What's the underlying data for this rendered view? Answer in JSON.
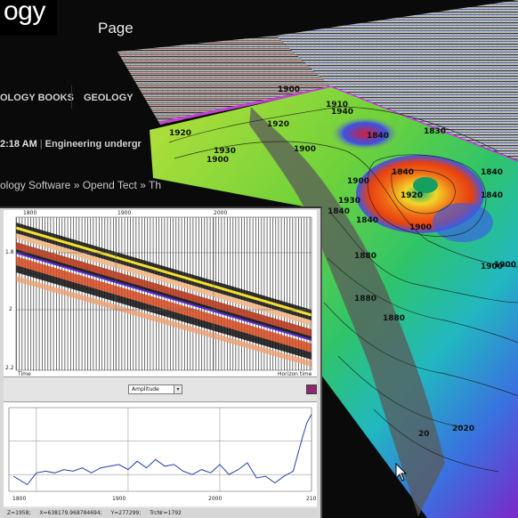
{
  "site": {
    "logo": "ogy",
    "logo_sub": "Page",
    "nav": [
      "OLOGY BOOKS",
      "GEOLOGY"
    ],
    "ticker": {
      "time": "2:18 AM",
      "separator": "|",
      "headline": "Engineering undergr"
    },
    "breadcrumb": "ology Software » Opend Tect » Th"
  },
  "scene": {
    "contour_labels": [
      "1900",
      "1910",
      "1920",
      "1940",
      "1930",
      "1920",
      "1900",
      "1900",
      "1840",
      "1830",
      "1840",
      "1920",
      "1900",
      "1840",
      "1840",
      "1930",
      "1900",
      "1900",
      "1880",
      "1880",
      "1900",
      "1880",
      "1840",
      "1840",
      "2020",
      "20"
    ]
  },
  "window": {
    "trace_axis": {
      "x_ticks": [
        "1800",
        "1900",
        "2000"
      ],
      "y_ticks": [
        "1.8",
        "2",
        "2.2"
      ],
      "left_label": "Time",
      "right_label": "Horizon time"
    },
    "attribute_select": "Amplitude",
    "amp_axis": {
      "x_ticks": [
        "1800",
        "1900",
        "2000",
        "210"
      ]
    },
    "status": {
      "z": "Z=1958;",
      "x": "X=638179.968784694;",
      "y": "Y=277299;",
      "trc": "TrcNr=1792"
    }
  },
  "chart_data": {
    "type": "line",
    "x": [
      1775,
      1790,
      1800,
      1810,
      1820,
      1830,
      1840,
      1850,
      1860,
      1870,
      1880,
      1890,
      1900,
      1910,
      1920,
      1930,
      1940,
      1950,
      1960,
      1970,
      1980,
      1990,
      2000,
      2010,
      2020,
      2030,
      2040,
      2050,
      2060,
      2070,
      2080,
      2090,
      2095,
      2100
    ],
    "values": [
      -0.55,
      -0.8,
      -0.45,
      -0.4,
      -0.45,
      -0.35,
      -0.4,
      -0.3,
      -0.45,
      -0.3,
      -0.25,
      -0.2,
      -0.35,
      -0.1,
      -0.3,
      -0.05,
      -0.25,
      -0.2,
      -0.4,
      -0.5,
      -0.35,
      -0.45,
      -0.2,
      -0.5,
      -0.35,
      -0.15,
      -0.6,
      -0.55,
      -0.75,
      -0.55,
      -0.4,
      0.6,
      1.05,
      1.3
    ],
    "xlim": [
      1770,
      2100
    ],
    "ylim": [
      -1,
      1.5
    ],
    "color": "#2a3fb0",
    "grid": true
  }
}
